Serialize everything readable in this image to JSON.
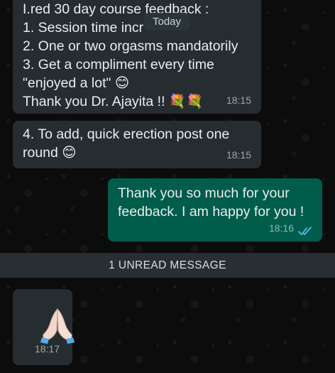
{
  "header": {
    "date_label": "Today"
  },
  "messages": [
    {
      "lines": [
        "I.red 30 day course feedback :",
        "1. Session time incr",
        "2. One or two orgasms mandatorily",
        "3. Get a compliment every time",
        "\"enjoyed a lot\" 😊",
        "Thank you Dr. Ajayita !! 💐💐"
      ],
      "time": "18:15"
    },
    {
      "lines": [
        "4. To add, quick erection post one",
        "round 😊"
      ],
      "time": "18:15"
    },
    {
      "lines": [
        "Thank you so much for your",
        "feedback. I am happy for you !"
      ],
      "time": "18:16",
      "tick_status": "read"
    },
    {
      "emoji": "🙏",
      "time": "18:17"
    }
  ],
  "unread_banner": "1 UNREAD MESSAGE",
  "colors": {
    "incoming_bubble": "#262d31",
    "outgoing_bubble": "#005c4b",
    "read_tick": "#53bdeb"
  }
}
